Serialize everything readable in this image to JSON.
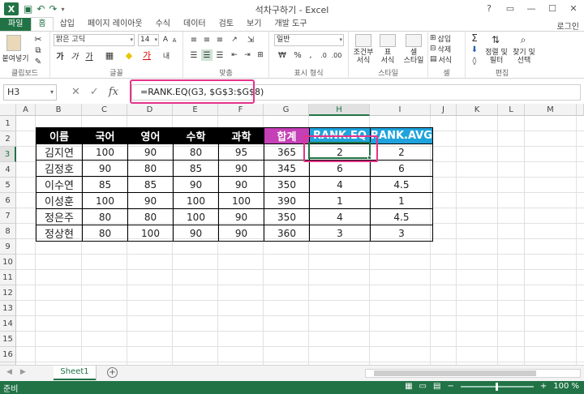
{
  "app": {
    "title": "석차구하기 - Excel",
    "login": "로그인"
  },
  "ribbon_tabs": [
    "파일",
    "홈",
    "삽입",
    "페이지 레이아웃",
    "수식",
    "데이터",
    "검토",
    "보기",
    "개발 도구"
  ],
  "ribbon": {
    "clipboard": {
      "paste": "붙여넣기",
      "label": "클립보드"
    },
    "font": {
      "name": "맑은 고딕",
      "size": "14",
      "label": "글꼴"
    },
    "alignment": {
      "label": "맞춤"
    },
    "number": {
      "format": "일반",
      "label": "표시 형식"
    },
    "styles": {
      "conditional": "조건부\n서식",
      "table": "표\n서식",
      "cell": "셀\n스타일",
      "label": "스타일"
    },
    "cells": {
      "insert": "삽입",
      "delete": "삭제",
      "format": "서식",
      "label": "셀"
    },
    "editing": {
      "sort": "정렬 및\n필터",
      "find": "찾기 및\n선택",
      "label": "편집"
    }
  },
  "formula_bar": {
    "name_box": "H3",
    "formula": "=RANK.EQ(G3, $G$3:$G$8)"
  },
  "columns": [
    "A",
    "B",
    "C",
    "D",
    "E",
    "F",
    "G",
    "H",
    "I",
    "J",
    "K",
    "L",
    "M"
  ],
  "rows": [
    "1",
    "2",
    "3",
    "4",
    "5",
    "6",
    "7",
    "8",
    "9",
    "10",
    "11",
    "12",
    "13",
    "14",
    "15",
    "16",
    "17",
    "18",
    "19"
  ],
  "table": {
    "headers": [
      "이름",
      "국어",
      "영어",
      "수학",
      "과학",
      "합계",
      "RANK.EQ",
      "RANK.AVG"
    ],
    "rows": [
      [
        "김지연",
        "100",
        "90",
        "80",
        "95",
        "365",
        "2",
        "2"
      ],
      [
        "김정호",
        "90",
        "80",
        "85",
        "90",
        "345",
        "6",
        "6"
      ],
      [
        "이수연",
        "85",
        "85",
        "90",
        "90",
        "350",
        "4",
        "4.5"
      ],
      [
        "이성훈",
        "100",
        "90",
        "100",
        "100",
        "390",
        "1",
        "1"
      ],
      [
        "정은주",
        "80",
        "80",
        "100",
        "90",
        "350",
        "4",
        "4.5"
      ],
      [
        "정상현",
        "80",
        "100",
        "90",
        "90",
        "360",
        "3",
        "3"
      ]
    ]
  },
  "sheet": {
    "tab": "Sheet1"
  },
  "status": {
    "mode": "준비",
    "zoom": "100 %"
  },
  "colors": {
    "accent": "#217346",
    "highlight": "#e6338a",
    "sum_header": "#c53fb6",
    "rank_header": "#1fa3dc"
  }
}
